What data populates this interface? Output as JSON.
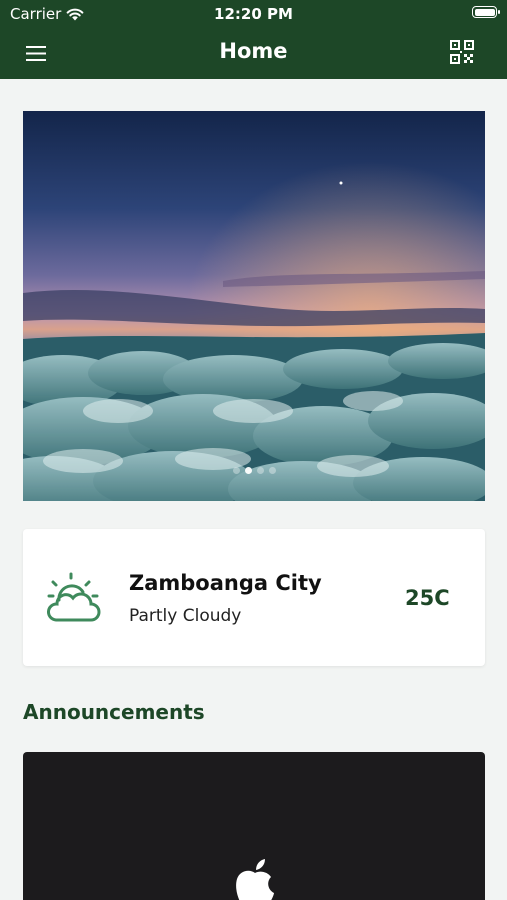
{
  "status_bar": {
    "carrier": "Carrier",
    "time": "12:20 PM"
  },
  "nav": {
    "title": "Home",
    "menu_icon": "hamburger-menu-icon",
    "qr_icon": "qr-scan-icon"
  },
  "carousel": {
    "slide_count": 4,
    "active_index": 1
  },
  "weather": {
    "city": "Zamboanga City",
    "condition": "Partly Cloudy",
    "temperature": "25C",
    "icon": "partly-cloudy-icon"
  },
  "announcements": {
    "title": "Announcements",
    "card_icon": "apple-logo-icon"
  },
  "colors": {
    "header_bg": "#1d4727",
    "accent": "#1d4727",
    "weather_icon": "#3f8a5c",
    "background": "#f2f4f3",
    "announcement_bg": "#1c1b1d"
  }
}
